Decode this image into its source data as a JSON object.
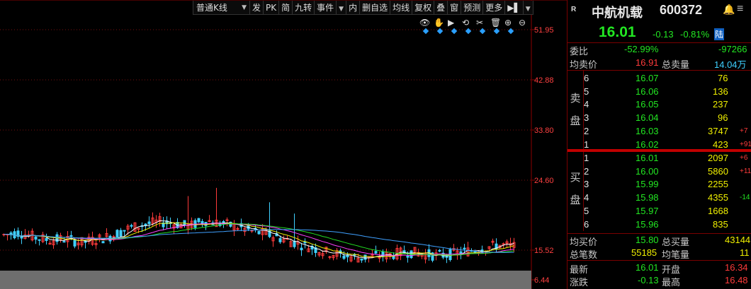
{
  "toolbar": {
    "period": "普通K线",
    "items": [
      "发",
      "PK",
      "简",
      "九转",
      "事件"
    ],
    "items2": [
      "内",
      "删自选",
      "均线",
      "复权",
      "叠",
      "窗",
      "预测",
      "更多"
    ]
  },
  "price_axis": [
    "51.95",
    "42.88",
    "33.80",
    "24.60",
    "15.52",
    "6.44"
  ],
  "stock": {
    "badge": "R",
    "name": "中航机载",
    "code": "600372",
    "price": "16.01",
    "change": "-0.13",
    "pct": "-0.81%",
    "tag": "陆"
  },
  "weibi": {
    "label": "委比",
    "pct": "-52.99%",
    "diff": "-97266"
  },
  "avg_sell": {
    "label": "均卖价",
    "value": "16.91",
    "total_label": "总卖量",
    "total": "14.04万"
  },
  "sell_label": [
    "卖",
    "盘"
  ],
  "buy_label": [
    "买",
    "盘"
  ],
  "asks": [
    {
      "lvl": "6",
      "price": "16.07",
      "vol": "76",
      "chg": ""
    },
    {
      "lvl": "5",
      "price": "16.06",
      "vol": "136",
      "chg": ""
    },
    {
      "lvl": "4",
      "price": "16.05",
      "vol": "237",
      "chg": ""
    },
    {
      "lvl": "3",
      "price": "16.04",
      "vol": "96",
      "chg": ""
    },
    {
      "lvl": "2",
      "price": "16.03",
      "vol": "3747",
      "chg": "+7"
    },
    {
      "lvl": "1",
      "price": "16.02",
      "vol": "423",
      "chg": "+91"
    }
  ],
  "bids": [
    {
      "lvl": "1",
      "price": "16.01",
      "vol": "2097",
      "chg": "+6"
    },
    {
      "lvl": "2",
      "price": "16.00",
      "vol": "5860",
      "chg": "+11"
    },
    {
      "lvl": "3",
      "price": "15.99",
      "vol": "2255",
      "chg": ""
    },
    {
      "lvl": "4",
      "price": "15.98",
      "vol": "4355",
      "chg": "-14"
    },
    {
      "lvl": "5",
      "price": "15.97",
      "vol": "1668",
      "chg": ""
    },
    {
      "lvl": "6",
      "price": "15.96",
      "vol": "835",
      "chg": ""
    }
  ],
  "avg_buy": {
    "label": "均买价",
    "value": "15.80",
    "total_label": "总买量",
    "total": "43144"
  },
  "trades": {
    "label": "总笔数",
    "value": "55185",
    "avg_label": "均笔量",
    "avg": "11"
  },
  "latest": {
    "label": "最新",
    "value": "16.01",
    "open_label": "开盘",
    "open": "16.34"
  },
  "change": {
    "label": "涨跌",
    "value": "-0.13",
    "high_label": "最高",
    "high": "16.48"
  },
  "colors": {
    "up": "#ff3b3b",
    "down": "#3fd0ff",
    "ma5": "#ffffff",
    "ma10": "#f0f000",
    "ma20": "#ff40ff",
    "ma30": "#22dd22",
    "ma60": "#3fa0ff"
  }
}
